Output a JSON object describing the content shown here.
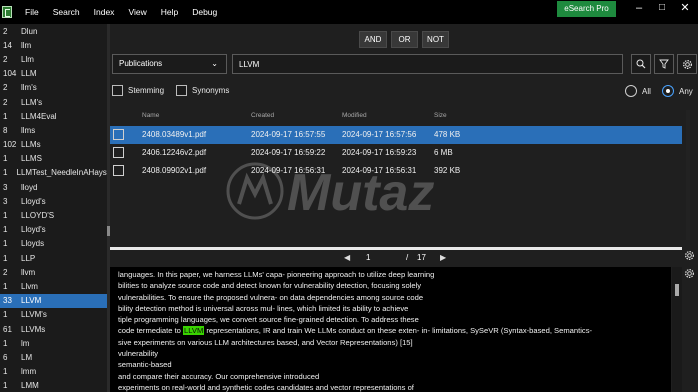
{
  "menu": {
    "items": [
      "File",
      "Search",
      "Index",
      "View",
      "Help",
      "Debug"
    ],
    "pro_label": "eSearch Pro"
  },
  "sidebar": {
    "items": [
      {
        "count": "2",
        "term": "Dlun"
      },
      {
        "count": "14",
        "term": "llm"
      },
      {
        "count": "2",
        "term": "Llm"
      },
      {
        "count": "104",
        "term": "LLM"
      },
      {
        "count": "2",
        "term": "llm's"
      },
      {
        "count": "2",
        "term": "LLM's"
      },
      {
        "count": "1",
        "term": "LLM4Eval"
      },
      {
        "count": "8",
        "term": "llms"
      },
      {
        "count": "102",
        "term": "LLMs"
      },
      {
        "count": "1",
        "term": "LLMS"
      },
      {
        "count": "1",
        "term": "LLMTest_NeedleInAHayst"
      },
      {
        "count": "3",
        "term": "lloyd"
      },
      {
        "count": "3",
        "term": "Lloyd's"
      },
      {
        "count": "1",
        "term": "LLOYD'S"
      },
      {
        "count": "1",
        "term": "Lloyd's"
      },
      {
        "count": "1",
        "term": "Lloyds"
      },
      {
        "count": "1",
        "term": "LLP"
      },
      {
        "count": "2",
        "term": "llvm"
      },
      {
        "count": "1",
        "term": "Llvm"
      },
      {
        "count": "33",
        "term": "LLVM"
      },
      {
        "count": "1",
        "term": "LLVM's"
      },
      {
        "count": "61",
        "term": "LLVMs"
      },
      {
        "count": "1",
        "term": "lm"
      },
      {
        "count": "6",
        "term": "LM"
      },
      {
        "count": "1",
        "term": "lmm"
      },
      {
        "count": "1",
        "term": "LMM"
      }
    ],
    "selected_index": 19
  },
  "operators": {
    "and": "AND",
    "or": "OR",
    "not": "NOT"
  },
  "search": {
    "field": "Publications",
    "query": "LLVM"
  },
  "options": {
    "stemming": "Stemming",
    "synonyms": "Synonyms",
    "all": "All",
    "any": "Any",
    "selected": "Any"
  },
  "table": {
    "headers": {
      "name": "Name",
      "created": "Created",
      "modified": "Modified",
      "size": "Size"
    },
    "rows": [
      {
        "name": "2408.03489v1.pdf",
        "created": "2024-09-17 16:57:55",
        "modified": "2024-09-17 16:57:56",
        "size": "478 KB"
      },
      {
        "name": "2406.12246v2.pdf",
        "created": "2024-09-17 16:59:22",
        "modified": "2024-09-17 16:59:23",
        "size": "6 MB"
      },
      {
        "name": "2408.09902v1.pdf",
        "created": "2024-09-17 16:56:31",
        "modified": "2024-09-17 16:56:31",
        "size": "392 KB"
      }
    ],
    "selected_index": 0
  },
  "watermark": "Mutaz",
  "pager": {
    "current": "1",
    "separator": "/",
    "total": "17"
  },
  "preview": {
    "lines": [
      "languages. In this paper, we harness LLMs' capa- pioneering approach to utilize deep learning",
      "bilities to analyze source code and detect known for vulnerability detection, focusing solely",
      "vulnerabilities. To ensure the proposed vulnera- on data dependencies among source code",
      "bility detection method is universal across mul- lines, which limited its ability to achieve",
      "tiple programming languages, we convert source fine-grained detection. To address these",
      "",
      "sive experiments on various LLM architectures based, and Vector Representations) [15]",
      "vulnerability",
      "semantic-based",
      "and compare their accuracy. Our comprehensive introduced",
      "experiments on real-world and synthetic codes candidates and vector representations of"
    ],
    "hl_before": "code termediate to ",
    "hl_word": "LLVM",
    "hl_after": " representations, IR and train We LLMs conduct on these exten- in- limitations, SySeVR (Syntax-based, Semantics-"
  },
  "colors": {
    "accent": "#2a6fb8",
    "pro_green": "#1e8a3e",
    "highlight": "#39d300"
  }
}
